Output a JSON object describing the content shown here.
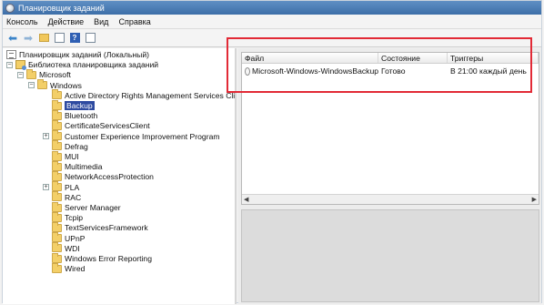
{
  "window": {
    "title": "Планировщик заданий"
  },
  "menu": [
    "Консоль",
    "Действие",
    "Вид",
    "Справка"
  ],
  "toolbar": {
    "icons": [
      "back-arrow-icon",
      "forward-arrow-icon",
      "up-folder-icon",
      "show-hide-pane-icon",
      "help-icon",
      "properties-icon"
    ]
  },
  "tree": [
    {
      "label": "Планировщик заданий (Локальный)",
      "icon": "scheduler-icon",
      "depth": 0,
      "expander": ""
    },
    {
      "label": "Библиотека планировщика заданий",
      "icon": "library-icon",
      "depth": 1,
      "expander": "−"
    },
    {
      "label": "Microsoft",
      "icon": "folder-icon",
      "depth": 2,
      "expander": "−"
    },
    {
      "label": "Windows",
      "icon": "folder-icon",
      "depth": 3,
      "expander": "−"
    },
    {
      "label": "Active Directory Rights Management Services Client",
      "icon": "folder-icon",
      "depth": 4,
      "expander": ""
    },
    {
      "label": "Backup",
      "icon": "folder-icon",
      "depth": 4,
      "expander": "",
      "selected": true
    },
    {
      "label": "Bluetooth",
      "icon": "folder-icon",
      "depth": 4,
      "expander": ""
    },
    {
      "label": "CertificateServicesClient",
      "icon": "folder-icon",
      "depth": 4,
      "expander": ""
    },
    {
      "label": "Customer Experience Improvement Program",
      "icon": "folder-icon",
      "depth": 4,
      "expander": "+"
    },
    {
      "label": "Defrag",
      "icon": "folder-icon",
      "depth": 4,
      "expander": ""
    },
    {
      "label": "MUI",
      "icon": "folder-icon",
      "depth": 4,
      "expander": ""
    },
    {
      "label": "Multimedia",
      "icon": "folder-icon",
      "depth": 4,
      "expander": ""
    },
    {
      "label": "NetworkAccessProtection",
      "icon": "folder-icon",
      "depth": 4,
      "expander": ""
    },
    {
      "label": "PLA",
      "icon": "folder-icon",
      "depth": 4,
      "expander": "+"
    },
    {
      "label": "RAC",
      "icon": "folder-icon",
      "depth": 4,
      "expander": ""
    },
    {
      "label": "Server Manager",
      "icon": "folder-icon",
      "depth": 4,
      "expander": ""
    },
    {
      "label": "Tcpip",
      "icon": "folder-icon",
      "depth": 4,
      "expander": ""
    },
    {
      "label": "TextServicesFramework",
      "icon": "folder-icon",
      "depth": 4,
      "expander": ""
    },
    {
      "label": "UPnP",
      "icon": "folder-icon",
      "depth": 4,
      "expander": ""
    },
    {
      "label": "WDI",
      "icon": "folder-icon",
      "depth": 4,
      "expander": ""
    },
    {
      "label": "Windows Error Reporting",
      "icon": "folder-icon",
      "depth": 4,
      "expander": ""
    },
    {
      "label": "Wired",
      "icon": "folder-icon",
      "depth": 4,
      "expander": ""
    }
  ],
  "task_list": {
    "columns": [
      "Файл",
      "Состояние",
      "Триггеры"
    ],
    "rows": [
      {
        "name": "Microsoft-Windows-WindowsBackup",
        "status": "Готово",
        "trigger": "В 21:00 каждый день"
      }
    ]
  },
  "colors": {
    "highlight": "#e22a36",
    "selection": "#2d4aa0",
    "titlebar": "#4a7cb6"
  }
}
